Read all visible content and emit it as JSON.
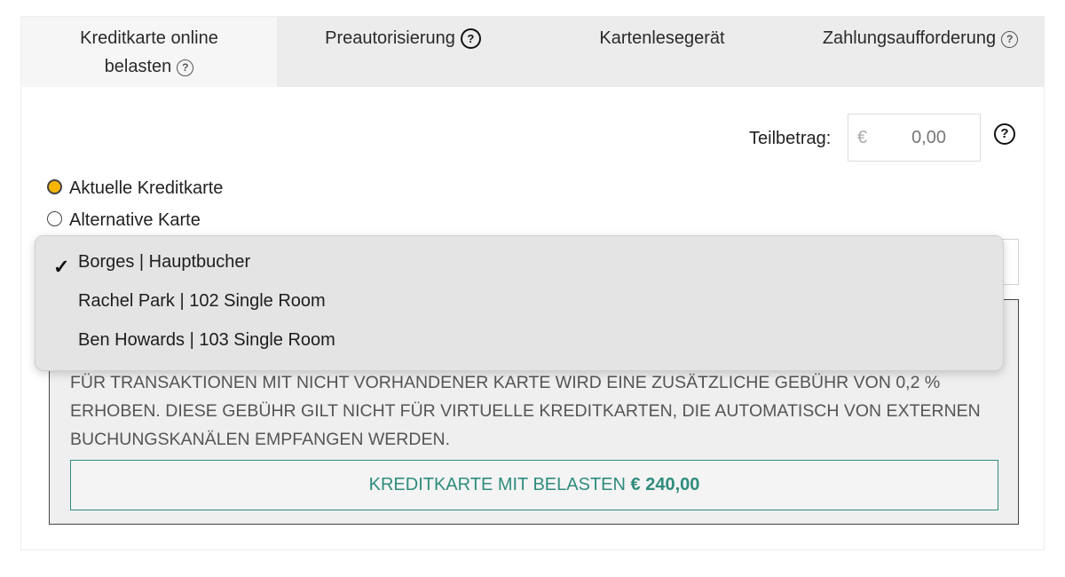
{
  "tabs": [
    {
      "label_line1": "Kreditkarte online",
      "label_line2": "belasten",
      "active": true
    },
    {
      "label": "Preautorisierung"
    },
    {
      "label": "Kartenlesegerät"
    },
    {
      "label": "Zahlungsaufforderung"
    }
  ],
  "partial_amount": {
    "label": "Teilbetrag:",
    "currency": "€",
    "value": "0,00"
  },
  "card_options": [
    {
      "label": "Aktuelle Kreditkarte",
      "selected": true
    },
    {
      "label": "Alternative Karte",
      "selected": false
    }
  ],
  "dropdown": {
    "items": [
      {
        "label": "Borges | Hauptbucher",
        "checked": true
      },
      {
        "label": "Rachel Park | 102 Single Room",
        "checked": false
      },
      {
        "label": "Ben Howards | 103 Single Room",
        "checked": false
      }
    ]
  },
  "notice": {
    "text": "FÜR TRANSAKTIONEN MIT NICHT VORHANDENER KARTE WIRD EINE ZUSÄTZLICHE GEBÜHR VON 0,2 % ERHOBEN. DIESE GEBÜHR GILT NICHT FÜR VIRTUELLE KREDITKARTEN, DIE AUTOMATISCH VON EXTERNEN BUCHUNGSKANÄLEN EMPFANGEN WERDEN."
  },
  "charge_button": {
    "label": "KREDITKARTE MIT BELASTEN",
    "amount": "€ 240,00"
  },
  "icons": {
    "help": "question-circle-icon",
    "check": "checkmark-icon"
  },
  "colors": {
    "accent": "#2f8c7e",
    "radio_selected": "#f7b500",
    "tab_bar": "#ececec"
  }
}
